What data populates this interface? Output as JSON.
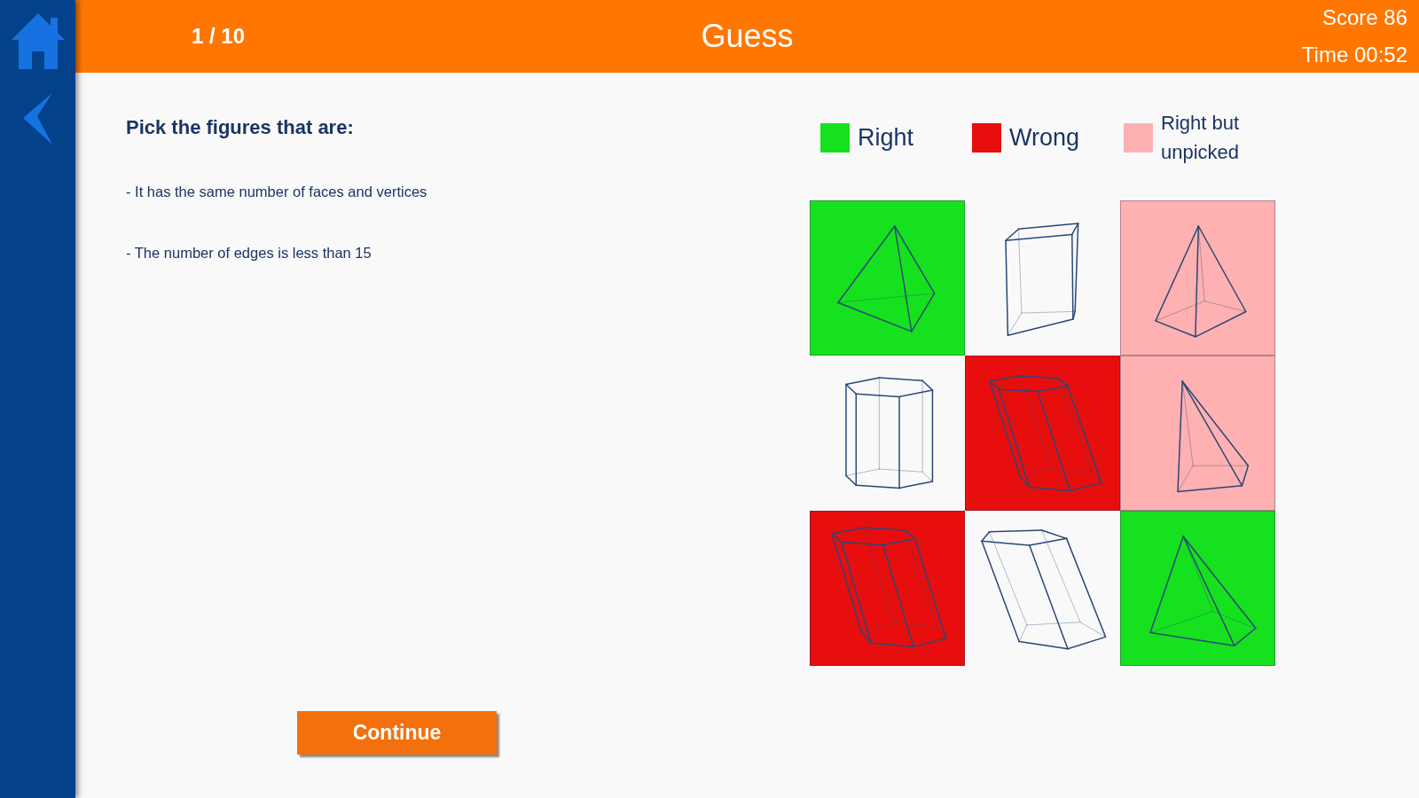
{
  "header": {
    "progress": "1 / 10",
    "title": "Guess",
    "score": "Score 86",
    "time": "Time 00:52"
  },
  "task": {
    "heading": "Pick the figures that are:",
    "criteria": [
      "- It has the same number of faces and vertices",
      "- The number of edges is less than 15"
    ]
  },
  "legend": [
    {
      "label": "Right",
      "color": "#16e11e"
    },
    {
      "label": "Wrong",
      "color": "#e80e0e"
    },
    {
      "label": "Right but unpicked",
      "color": "#ffb1b1"
    }
  ],
  "grid": {
    "cells": [
      {
        "picked": true,
        "correct": true
      },
      {
        "picked": false,
        "correct": false
      },
      {
        "picked": false,
        "correct": true
      },
      {
        "picked": false,
        "correct": false
      },
      {
        "picked": true,
        "correct": false
      },
      {
        "picked": false,
        "correct": true
      },
      {
        "picked": true,
        "correct": false
      },
      {
        "picked": false,
        "correct": false
      },
      {
        "picked": true,
        "correct": true
      }
    ]
  },
  "continue_button": {
    "label": "Continue"
  }
}
